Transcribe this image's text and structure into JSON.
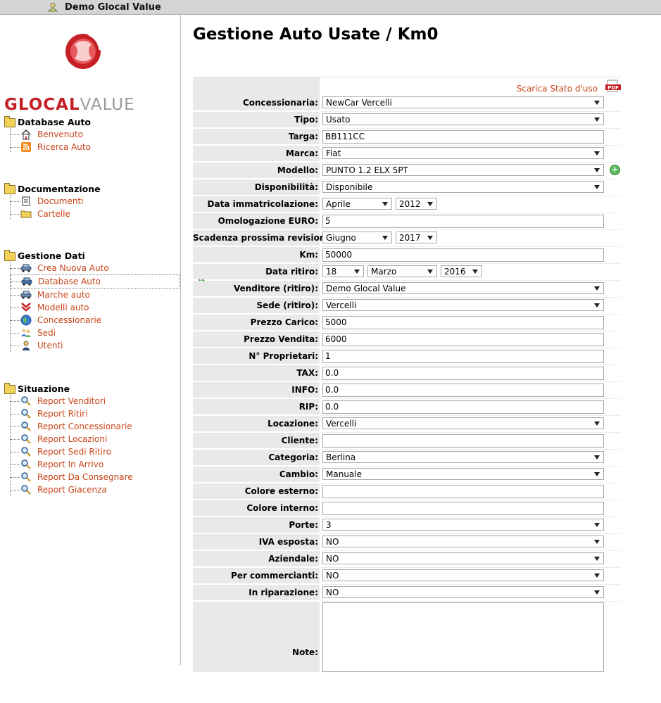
{
  "header": {
    "user_name": "Demo Glocal Value"
  },
  "logo": {
    "brand_red": "GLOCAL",
    "brand_gray": "VALUE"
  },
  "sidebar": {
    "sections": [
      {
        "title": "Database Auto",
        "items": [
          {
            "label": "Benvenuto",
            "icon": "home-icon"
          },
          {
            "label": "Ricerca Auto",
            "icon": "rss-icon"
          }
        ]
      },
      {
        "title": "Documentazione",
        "items": [
          {
            "label": "Documenti",
            "icon": "document-icon"
          },
          {
            "label": "Cartelle",
            "icon": "folder-icon"
          }
        ]
      },
      {
        "title": "Gestione Dati",
        "items": [
          {
            "label": "Crea Nuova Auto",
            "icon": "car-add-icon"
          },
          {
            "label": "Database Auto",
            "icon": "car-icon"
          },
          {
            "label": "Marche auto",
            "icon": "car-brand-icon"
          },
          {
            "label": "Modelli auto",
            "icon": "model-icon"
          },
          {
            "label": "Concessionarie",
            "icon": "globe-icon"
          },
          {
            "label": "Sedi",
            "icon": "users-icon"
          },
          {
            "label": "Utenti",
            "icon": "user-icon"
          }
        ]
      },
      {
        "title": "Situazione",
        "items": [
          {
            "label": "Report Venditori"
          },
          {
            "label": "Report Ritiri"
          },
          {
            "label": "Report Concessionarie"
          },
          {
            "label": "Report Locazioni"
          },
          {
            "label": "Report Sedi Ritiro"
          },
          {
            "label": "Report In Arrivo"
          },
          {
            "label": "Report Da Consegnare"
          },
          {
            "label": "Report Giacenza"
          }
        ]
      }
    ]
  },
  "main": {
    "title": "Gestione Auto Usate / Km0",
    "pdf_link": "Scarica Stato d'uso",
    "pdf_icon_label": "PDF",
    "form": {
      "concessionaria": {
        "label": "Concessionaria:",
        "value": "NewCar Vercelli"
      },
      "tipo": {
        "label": "Tipo:",
        "value": "Usato"
      },
      "targa": {
        "label": "Targa:",
        "value": "BB111CC"
      },
      "marca": {
        "label": "Marca:",
        "value": "Fiat"
      },
      "modello": {
        "label": "Modello:",
        "value": "PUNTO 1.2 ELX 5PT"
      },
      "disponibilita": {
        "label": "Disponibilità:",
        "value": "Disponibile"
      },
      "data_immatricolazione": {
        "label": "Data immatricolazione:",
        "month": "Aprile",
        "year": "2012"
      },
      "omologazione": {
        "label": "Omologazione EURO:",
        "value": "5"
      },
      "scadenza_revisione": {
        "label": "Scadenza prossima revisione:",
        "month": "Giugno",
        "year": "2017"
      },
      "km": {
        "label": "Km:",
        "value": "50000"
      },
      "data_ritiro": {
        "label": "Data ritiro:",
        "day": "18",
        "month": "Marzo",
        "year": "2016"
      },
      "venditore": {
        "label": "Venditore (ritiro):",
        "value": "Demo Glocal Value"
      },
      "sede": {
        "label": "Sede (ritiro):",
        "value": "Vercelli"
      },
      "prezzo_carico": {
        "label": "Prezzo Carico:",
        "value": "5000"
      },
      "prezzo_vendita": {
        "label": "Prezzo Vendita:",
        "value": "6000"
      },
      "proprietari": {
        "label": "N° Proprietari:",
        "value": "1"
      },
      "tax": {
        "label": "TAX:",
        "value": "0.0"
      },
      "info": {
        "label": "INFO:",
        "value": "0.0"
      },
      "rip": {
        "label": "RIP:",
        "value": "0.0"
      },
      "locazione": {
        "label": "Locazione:",
        "value": "Vercelli"
      },
      "cliente": {
        "label": "Cliente:",
        "value": ""
      },
      "categoria": {
        "label": "Categoria:",
        "value": "Berlina"
      },
      "cambio": {
        "label": "Cambio:",
        "value": "Manuale"
      },
      "colore_esterno": {
        "label": "Colore esterno:",
        "value": ""
      },
      "colore_interno": {
        "label": "Colore interno:",
        "value": ""
      },
      "porte": {
        "label": "Porte:",
        "value": "3"
      },
      "iva": {
        "label": "IVA esposta:",
        "value": "NO"
      },
      "aziendale": {
        "label": "Aziendale:",
        "value": "NO"
      },
      "commercianti": {
        "label": "Per commercianti:",
        "value": "NO"
      },
      "riparazione": {
        "label": "In riparazione:",
        "value": "NO"
      },
      "note": {
        "label": "Note:",
        "value": ""
      }
    }
  }
}
